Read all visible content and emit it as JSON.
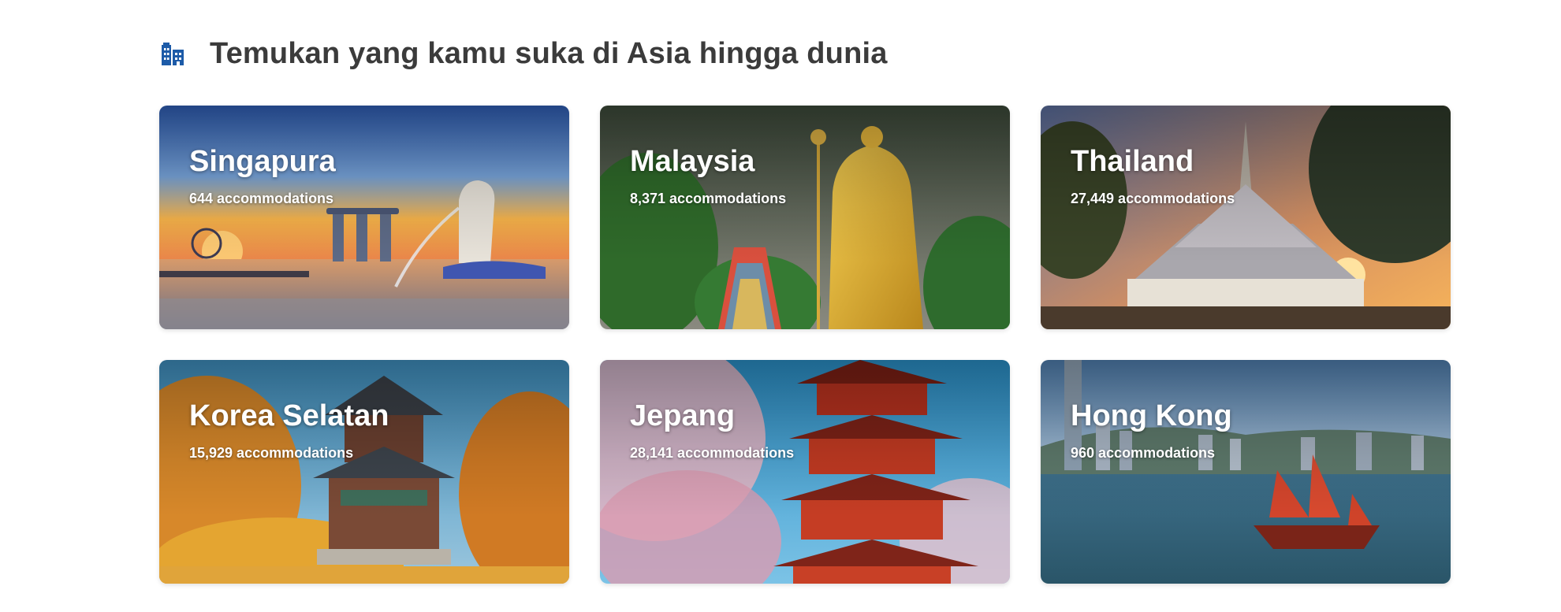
{
  "section": {
    "title": "Temukan yang kamu suka di Asia hingga dunia",
    "icon": "building-icon",
    "icon_color": "#1d5ba8"
  },
  "destinations": [
    {
      "name": "Singapura",
      "count": "644 accommodations"
    },
    {
      "name": "Malaysia",
      "count": "8,371 accommodations"
    },
    {
      "name": "Thailand",
      "count": "27,449 accommodations"
    },
    {
      "name": "Korea Selatan",
      "count": "15,929 accommodations"
    },
    {
      "name": "Jepang",
      "count": "28,141 accommodations"
    },
    {
      "name": "Hong Kong",
      "count": "960 accommodations"
    }
  ]
}
